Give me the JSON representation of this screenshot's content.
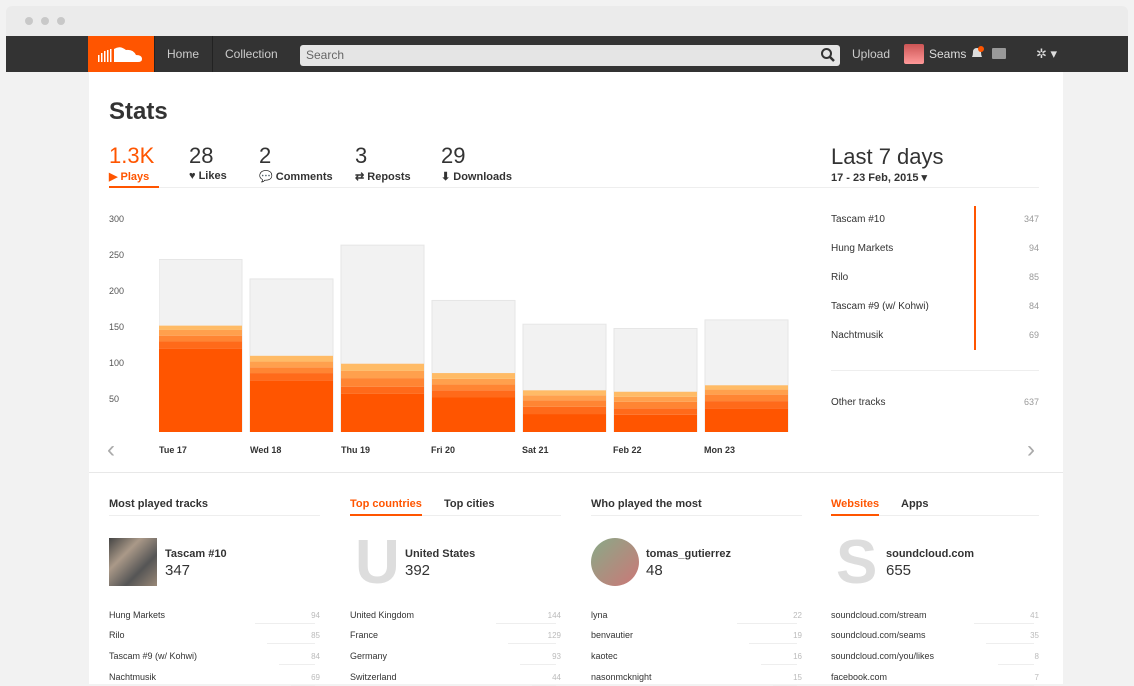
{
  "window": {
    "title": ""
  },
  "nav": {
    "home": "Home",
    "collection": "Collection",
    "search_placeholder": "Search",
    "upload": "Upload",
    "user": "Seams"
  },
  "page": {
    "title": "Stats"
  },
  "stats": [
    {
      "num": "1.3K",
      "label": "▶ Plays"
    },
    {
      "num": "28",
      "label": "♥ Likes"
    },
    {
      "num": "2",
      "label": "💬 Comments"
    },
    {
      "num": "3",
      "label": "⇄ Reposts"
    },
    {
      "num": "29",
      "label": "⬇ Downloads"
    }
  ],
  "range": {
    "title": "Last 7 days",
    "subtitle": "17 - 23 Feb, 2015 ▾"
  },
  "chart_data": {
    "type": "bar",
    "categories": [
      "Tue 17",
      "Wed 18",
      "Thu 19",
      "Fri 20",
      "Sat 21",
      "Feb 22",
      "Mon 23"
    ],
    "totals": [
      240,
      213,
      260,
      183,
      150,
      144,
      156
    ],
    "series": [
      {
        "name": "Tascam #10",
        "values": [
          116,
          72,
          53,
          48,
          25,
          24,
          33
        ]
      },
      {
        "name": "Hung Markets",
        "values": [
          10,
          10,
          10,
          10,
          10,
          9,
          10
        ]
      },
      {
        "name": "Rilo",
        "values": [
          8,
          8,
          12,
          8,
          9,
          9,
          9
        ]
      },
      {
        "name": "Tascam #9 (w/ Kohwi)",
        "values": [
          8,
          8,
          10,
          8,
          7,
          7,
          7
        ]
      },
      {
        "name": "Nachtmusik",
        "values": [
          6,
          8,
          10,
          8,
          7,
          7,
          6
        ]
      }
    ],
    "yticks": [
      "300",
      "250",
      "200",
      "150",
      "100",
      "50"
    ],
    "ylim": [
      0,
      300
    ],
    "colors": [
      "#ff5500",
      "#ff6a1a",
      "#ff8533",
      "#ffa04d",
      "#ffbb66"
    ],
    "background_color": "#f2f2f2"
  },
  "tracks": [
    {
      "name": "Tascam #10",
      "value": "347"
    },
    {
      "name": "Hung Markets",
      "value": "94"
    },
    {
      "name": "Rilo",
      "value": "85"
    },
    {
      "name": "Tascam #9 (w/ Kohwi)",
      "value": "84"
    },
    {
      "name": "Nachtmusik",
      "value": "69"
    }
  ],
  "other_tracks": {
    "name": "Other tracks",
    "value": "637"
  },
  "sections": {
    "most_played": {
      "title": "Most played tracks",
      "featured_name": "Tascam #10",
      "featured_value": "347",
      "items": [
        {
          "label": "Hung Markets",
          "value": "94"
        },
        {
          "label": "Rilo",
          "value": "85"
        },
        {
          "label": "Tascam #9 (w/ Kohwi)",
          "value": "84"
        },
        {
          "label": "Nachtmusik",
          "value": "69"
        }
      ]
    },
    "countries": {
      "tab1": "Top countries",
      "tab2": "Top cities",
      "letter": "U",
      "featured_name": "United States",
      "featured_value": "392",
      "items": [
        {
          "label": "United Kingdom",
          "value": "144"
        },
        {
          "label": "France",
          "value": "129"
        },
        {
          "label": "Germany",
          "value": "93"
        },
        {
          "label": "Switzerland",
          "value": "44"
        }
      ]
    },
    "who_played": {
      "title": "Who played the most",
      "featured_name": "tomas_gutierrez",
      "featured_value": "48",
      "items": [
        {
          "label": "lyna",
          "value": "22"
        },
        {
          "label": "benvautier",
          "value": "19"
        },
        {
          "label": "kaotec",
          "value": "16"
        },
        {
          "label": "nasonmcknight",
          "value": "15"
        }
      ]
    },
    "websites": {
      "tab1": "Websites",
      "tab2": "Apps",
      "letter": "S",
      "featured_name": "soundcloud.com",
      "featured_value": "655",
      "items": [
        {
          "label": "soundcloud.com/stream",
          "value": "41"
        },
        {
          "label": "soundcloud.com/seams",
          "value": "35"
        },
        {
          "label": "soundcloud.com/you/likes",
          "value": "8"
        },
        {
          "label": "facebook.com",
          "value": "7"
        }
      ]
    }
  }
}
